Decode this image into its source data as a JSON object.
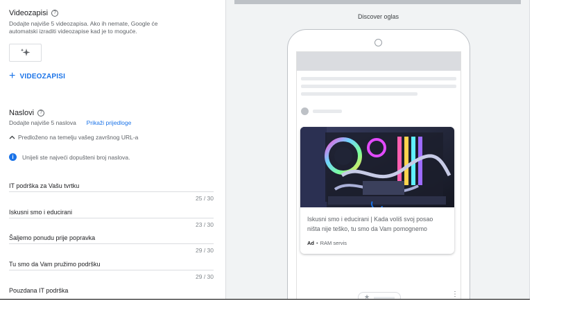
{
  "videos": {
    "title": "Videozapisi",
    "description_line1": "Dodajte najviše 5 videozapisa. Ako ih nemate, Google će",
    "description_line2": "automatski izraditi videozapise kad je to moguće.",
    "add_label": "VIDEOZAPISI"
  },
  "headlines": {
    "title": "Naslovi",
    "description": "Dodajte najviše 5 naslova",
    "show_suggestions": "Prikaži prijedloge",
    "suggested_label": "Predloženo na temelju vašeg završnog URL-a",
    "info_message": "Unijeli ste najveći dopušteni broj naslova.",
    "items": [
      {
        "text": "IT podrška za Vašu tvrtku",
        "count": "25 / 30"
      },
      {
        "text": "Iskusni smo i educirani",
        "count": "23 / 30"
      },
      {
        "text": "Šaljemo ponudu prije popravka",
        "count": "29 / 30"
      },
      {
        "text": "Tu smo da Vam pružimo podršku",
        "count": "29 / 30"
      },
      {
        "text": "Pouzdana IT podrška",
        "count": ""
      }
    ]
  },
  "preview": {
    "label": "Discover oglas",
    "ad_text_line1": "Iskusni smo i educirani | Kada voliš svoj posao",
    "ad_text_line2": "ništa nije teško, tu smo da Vam pomognemo",
    "ad_badge": "Ad",
    "ad_separator": "•",
    "advertiser": "RAM servis"
  },
  "colors": {
    "accent": "#1a73e8",
    "panel_bg": "#f1f3f4"
  }
}
